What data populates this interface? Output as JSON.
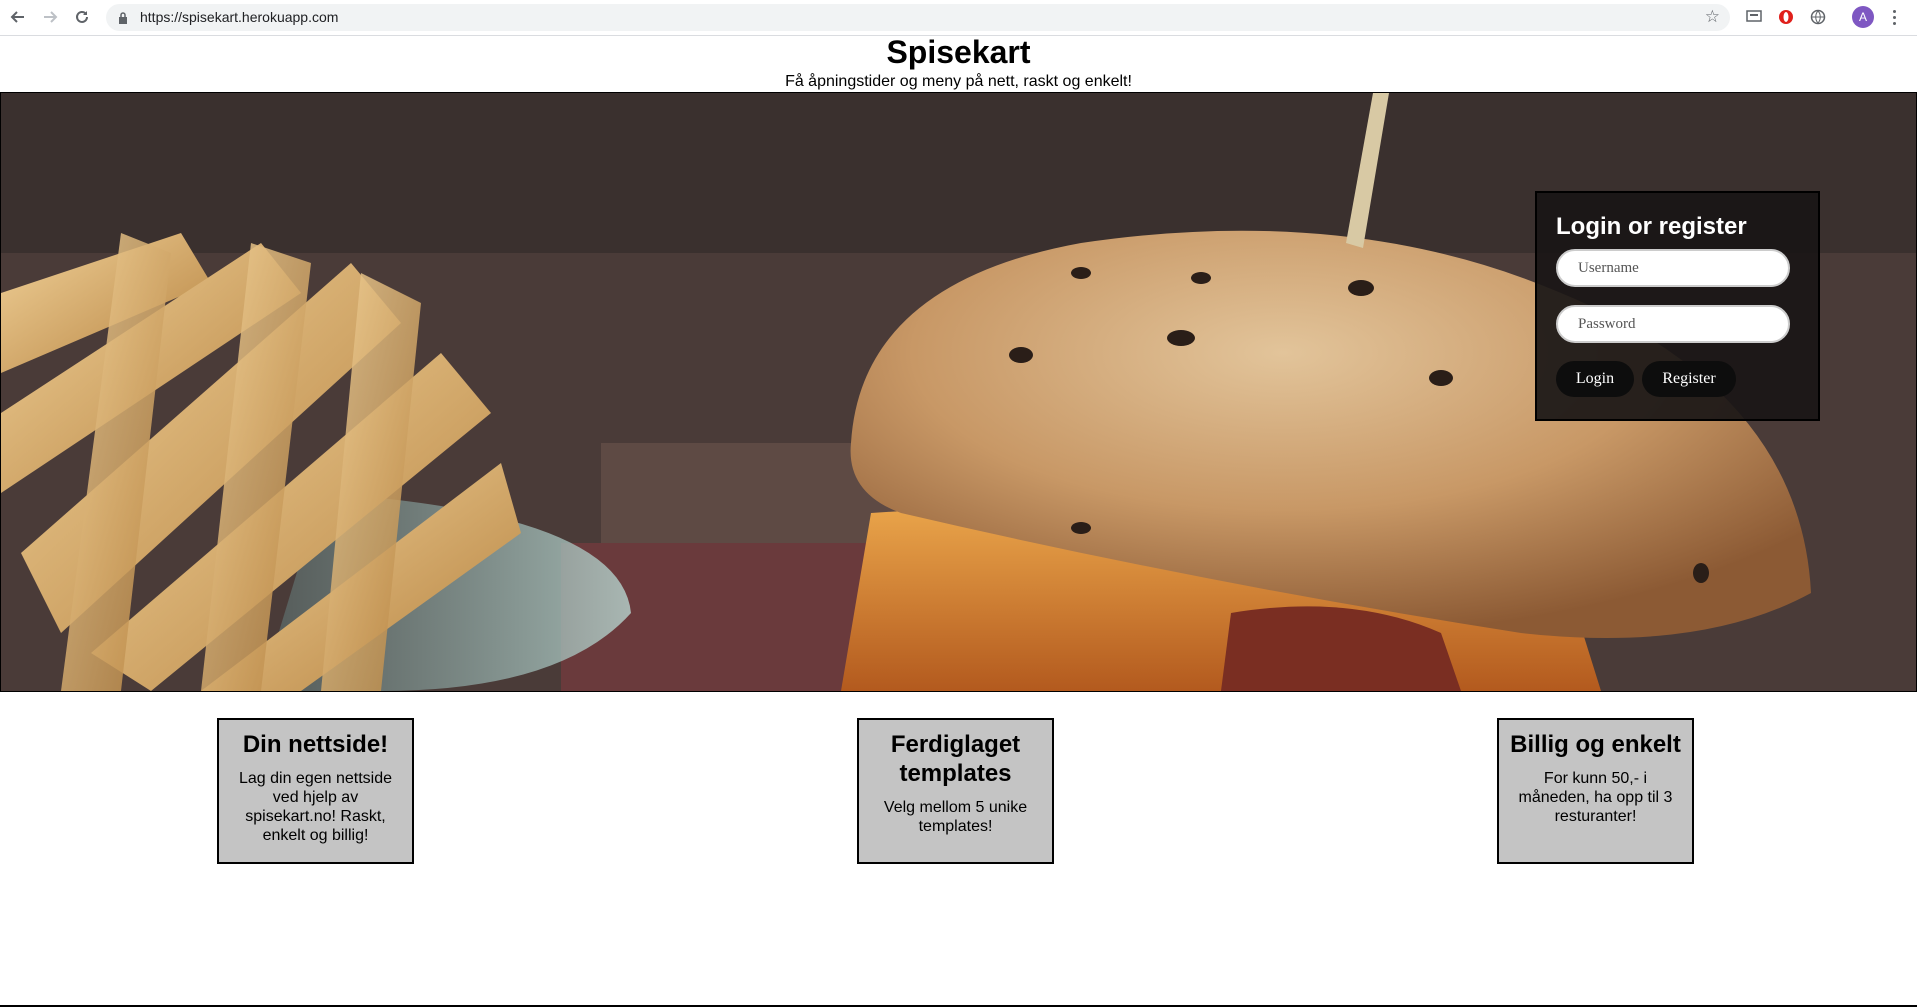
{
  "browser": {
    "url": "https://spisekart.herokuapp.com",
    "profile_initial": "A"
  },
  "header": {
    "title": "Spisekart",
    "subtitle": "Få åpningstider og meny på nett, raskt og enkelt!"
  },
  "login": {
    "title": "Login or register",
    "username_placeholder": "Username",
    "password_placeholder": "Password",
    "login_label": "Login",
    "register_label": "Register"
  },
  "features": [
    {
      "title": "Din nettside!",
      "text": "Lag din egen nettside ved hjelp av spisekart.no! Raskt, enkelt og billig!"
    },
    {
      "title": "Ferdiglaget templates",
      "text": "Velg mellom 5 unike templates!"
    },
    {
      "title": "Billig og enkelt",
      "text": "For kunn 50,- i måneden, ha opp til 3 resturanter!"
    }
  ]
}
